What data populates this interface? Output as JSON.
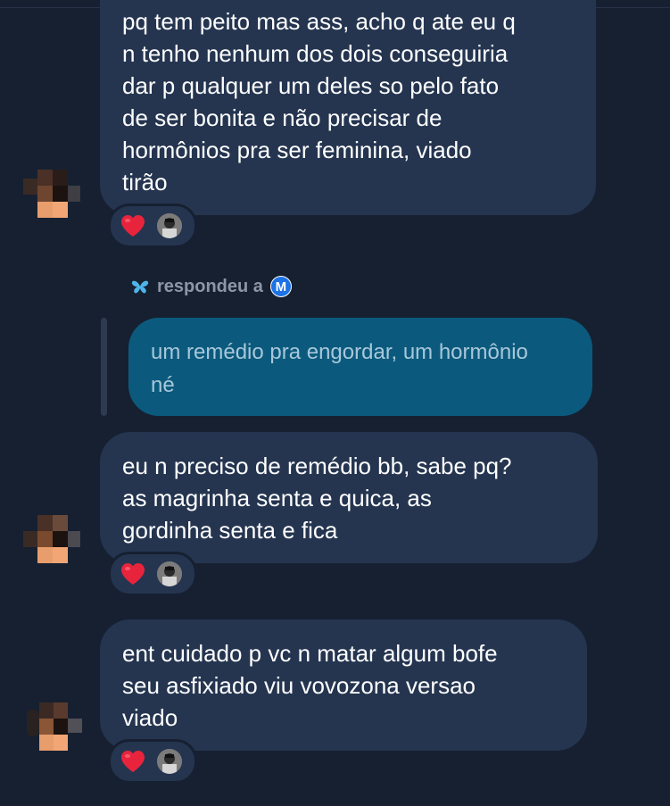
{
  "messages": [
    {
      "text": "pq tem peito mas ass, acho q ate eu q\nn tenho nenhum dos dois conseguiria\ndar p qualquer um deles so pelo fato\nde ser bonita e não precisar de\nhormônios pra ser feminina, viado\ntirão",
      "reaction": "heart"
    },
    {
      "text": "eu n preciso de remédio bb, sabe pq?\nas magrinha senta e quica, as\ngordinha senta e fica",
      "reaction": "heart"
    },
    {
      "text": "ent cuidado p vc n matar algum bofe\nseu asfixiado viu vovozona versao\nviado",
      "reaction": "heart"
    }
  ],
  "reply": {
    "label": "respondeu a",
    "replied_to_badge": "M",
    "quoted_text": "um remédio pra engordar, um hormônio\nné"
  },
  "colors": {
    "background": "#162031",
    "bubble": "#253550",
    "reply_bubble": "#0b5a7d",
    "heart": "#e8243c",
    "badge": "#1d72e5",
    "butterfly": "#4fb3ea"
  }
}
